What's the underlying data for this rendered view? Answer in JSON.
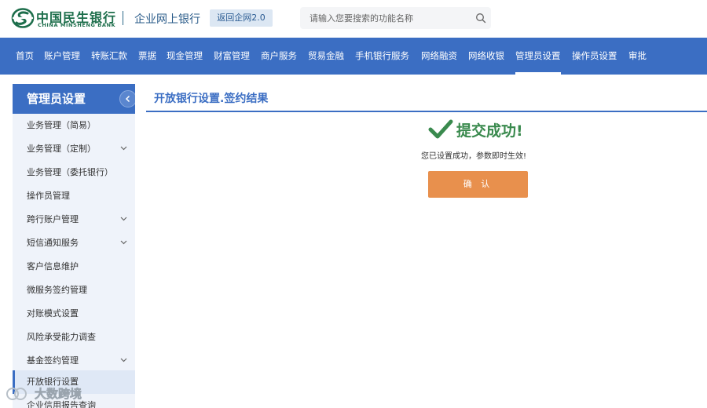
{
  "header": {
    "bank_name_cn": "中国民生银行",
    "bank_name_en": "CHINA MINSHENG BANK",
    "portal_title": "企业网上银行",
    "return_label": "返回企网2.0",
    "search": {
      "placeholder": "请输入您要搜索的功能名称",
      "value": "",
      "icon": "search-icon"
    },
    "brand_color": "#1d6e4b"
  },
  "nav": {
    "items": [
      {
        "label": "首页"
      },
      {
        "label": "账户管理"
      },
      {
        "label": "转账汇款"
      },
      {
        "label": "票据"
      },
      {
        "label": "现金管理"
      },
      {
        "label": "财富管理"
      },
      {
        "label": "商户服务"
      },
      {
        "label": "贸易金融"
      },
      {
        "label": "手机银行服务"
      },
      {
        "label": "网络融资"
      },
      {
        "label": "网络收银"
      },
      {
        "label": "管理员设置",
        "active": true
      },
      {
        "label": "操作员设置"
      },
      {
        "label": "审批"
      }
    ],
    "accent_color": "#3b6ec3"
  },
  "sidebar": {
    "title": "管理员设置",
    "items": [
      {
        "label": "业务管理（简易）",
        "expandable": false
      },
      {
        "label": "业务管理（定制）",
        "expandable": true
      },
      {
        "label": "业务管理（委托银行）",
        "expandable": false
      },
      {
        "label": "操作员管理",
        "expandable": false
      },
      {
        "label": "跨行账户管理",
        "expandable": true
      },
      {
        "label": "短信通知服务",
        "expandable": true
      },
      {
        "label": "客户信息维护",
        "expandable": false
      },
      {
        "label": "微服务签约管理",
        "expandable": false
      },
      {
        "label": "对账模式设置",
        "expandable": false
      },
      {
        "label": "风险承受能力调查",
        "expandable": false
      },
      {
        "label": "基金签约管理",
        "expandable": true
      },
      {
        "label": "开放银行设置",
        "expandable": false,
        "active": true
      },
      {
        "label": "企业信用报告查询",
        "expandable": false
      }
    ]
  },
  "main": {
    "title": "开放银行设置.签约结果",
    "success_title": "提交成功!",
    "success_message": "您已设置成功，参数即时生效!",
    "confirm_label": "确 认",
    "success_color": "#3a8a4e",
    "button_color": "#e8904d"
  },
  "watermark": {
    "text": "大数跨境"
  }
}
